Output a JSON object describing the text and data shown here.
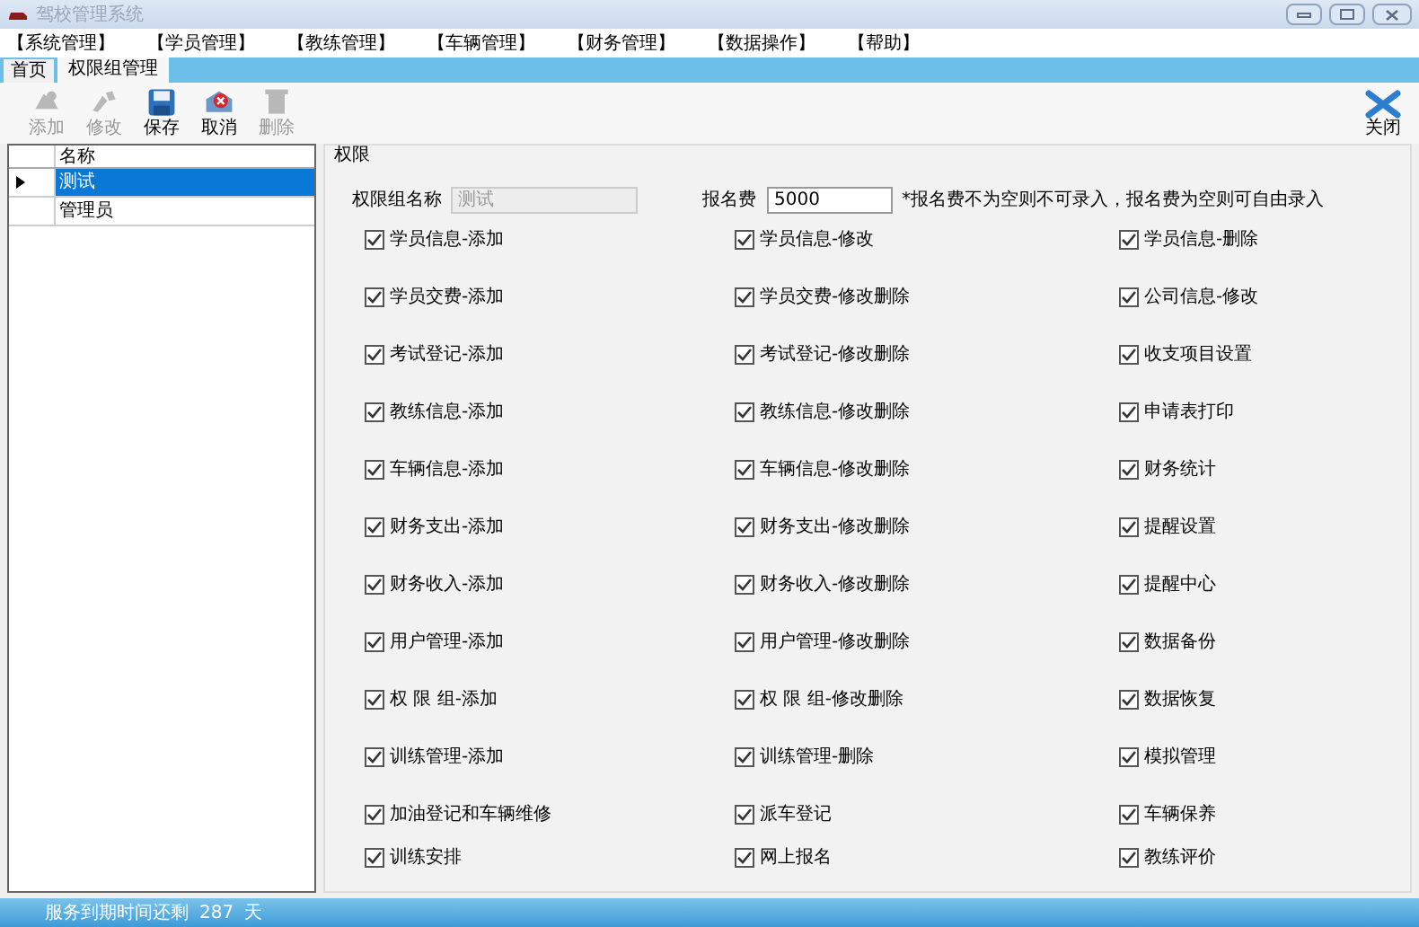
{
  "window": {
    "title": "驾校管理系统"
  },
  "menu": [
    "【系统管理】",
    "【学员管理】",
    "【教练管理】",
    "【车辆管理】",
    "【财务管理】",
    "【数据操作】",
    "【帮助】"
  ],
  "tabs": [
    {
      "label": "首页",
      "selected": false
    },
    {
      "label": "权限组管理",
      "selected": true
    }
  ],
  "toolbar": [
    {
      "label": "添加",
      "kind": "add",
      "disabled": true
    },
    {
      "label": "修改",
      "kind": "edit",
      "disabled": true
    },
    {
      "label": "保存",
      "kind": "save",
      "disabled": false
    },
    {
      "label": "取消",
      "kind": "cancel",
      "disabled": false
    },
    {
      "label": "删除",
      "kind": "delete",
      "disabled": true
    }
  ],
  "close_button": {
    "label": "关闭"
  },
  "group_table": {
    "columns": [
      "名称"
    ],
    "rows": [
      {
        "name": "测试",
        "selected": true
      },
      {
        "name": "管理员",
        "selected": false
      }
    ]
  },
  "permissions": {
    "title": "权限",
    "name_label": "权限组名称",
    "name_value": "测试",
    "fee_label": "报名费",
    "fee_value": "5000",
    "note": "*报名费不为空则不可录入，报名费为空则可自由录入",
    "items": [
      {
        "label": "学员信息-添加",
        "checked": true
      },
      {
        "label": "学员信息-修改",
        "checked": true
      },
      {
        "label": "学员信息-删除",
        "checked": true
      },
      {
        "label": "学员交费-添加",
        "checked": true
      },
      {
        "label": "学员交费-修改删除",
        "checked": true
      },
      {
        "label": "公司信息-修改",
        "checked": true
      },
      {
        "label": "考试登记-添加",
        "checked": true
      },
      {
        "label": "考试登记-修改删除",
        "checked": true
      },
      {
        "label": "收支项目设置",
        "checked": true
      },
      {
        "label": "教练信息-添加",
        "checked": true
      },
      {
        "label": "教练信息-修改删除",
        "checked": true
      },
      {
        "label": "申请表打印",
        "checked": true
      },
      {
        "label": "车辆信息-添加",
        "checked": true
      },
      {
        "label": "车辆信息-修改删除",
        "checked": true
      },
      {
        "label": "财务统计",
        "checked": true
      },
      {
        "label": "财务支出-添加",
        "checked": true
      },
      {
        "label": "财务支出-修改删除",
        "checked": true
      },
      {
        "label": "提醒设置",
        "checked": true
      },
      {
        "label": "财务收入-添加",
        "checked": true
      },
      {
        "label": "财务收入-修改删除",
        "checked": true
      },
      {
        "label": "提醒中心",
        "checked": true
      },
      {
        "label": "用户管理-添加",
        "checked": true
      },
      {
        "label": "用户管理-修改删除",
        "checked": true
      },
      {
        "label": "数据备份",
        "checked": true
      },
      {
        "label": "权 限 组-添加",
        "checked": true
      },
      {
        "label": "权 限 组-修改删除",
        "checked": true
      },
      {
        "label": "数据恢复",
        "checked": true
      },
      {
        "label": "训练管理-添加",
        "checked": true
      },
      {
        "label": "训练管理-删除",
        "checked": true
      },
      {
        "label": "模拟管理",
        "checked": true
      },
      {
        "label": "加油登记和车辆维修",
        "checked": true
      },
      {
        "label": "派车登记",
        "checked": true
      },
      {
        "label": "车辆保养",
        "checked": true
      },
      {
        "label": "训练安排",
        "checked": true
      },
      {
        "label": "网上报名",
        "checked": true
      },
      {
        "label": "教练评价",
        "checked": true
      }
    ]
  },
  "status_bar": {
    "text": "服务到期时间还剩",
    "days": "287",
    "unit": "天"
  }
}
